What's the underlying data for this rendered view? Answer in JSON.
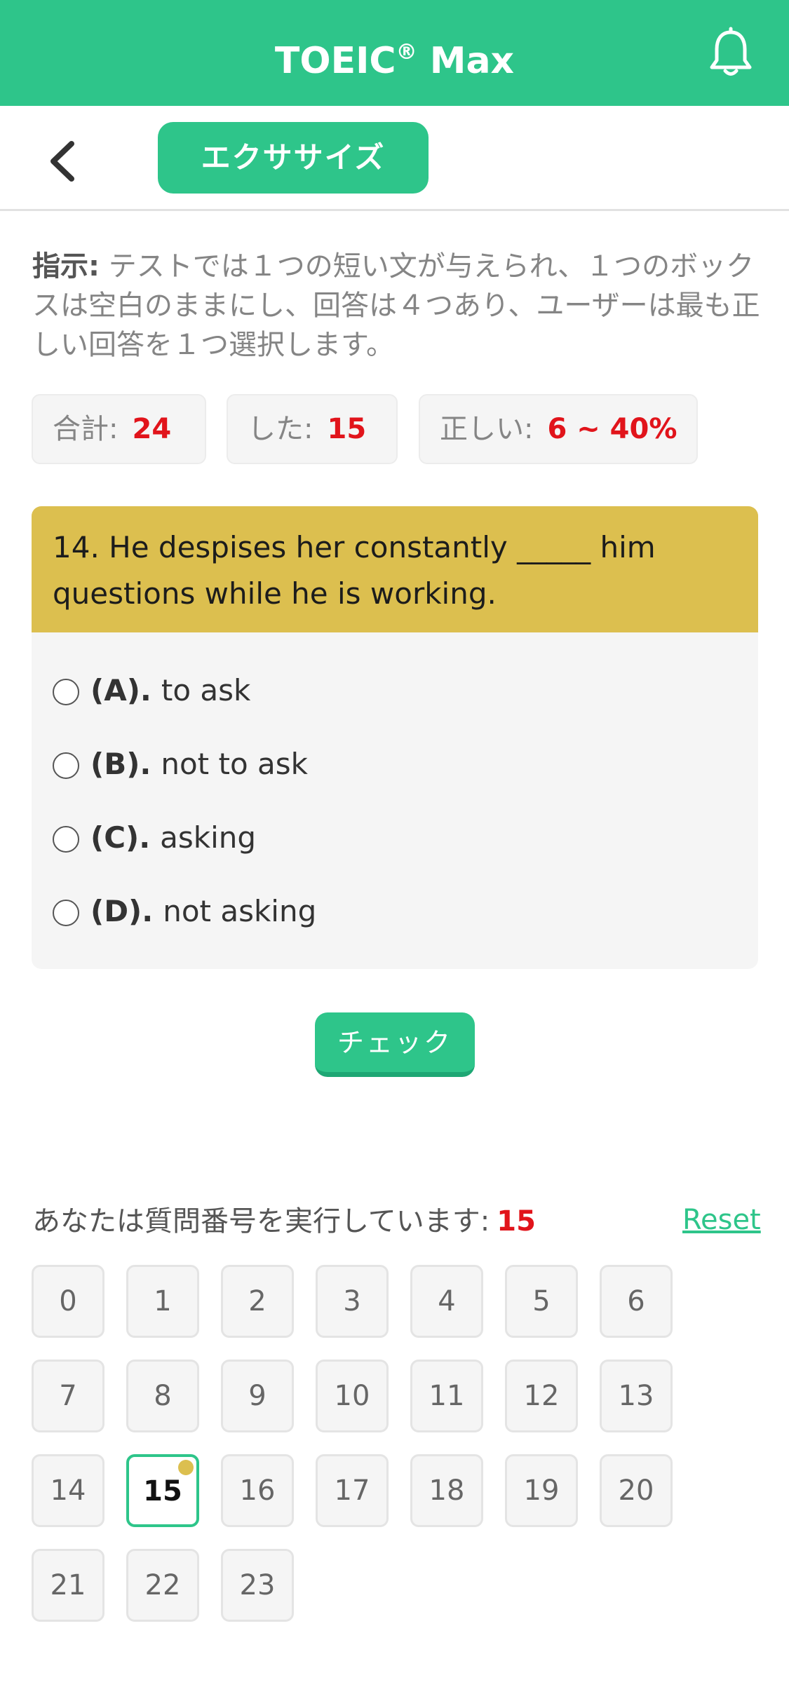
{
  "app": {
    "title": "TOEIC",
    "title_mark": "®",
    "title_suffix": " Max"
  },
  "icons": {
    "notification": "bell-icon",
    "back": "chevron-left-icon"
  },
  "nav": {
    "tab_label": "エクササイズ"
  },
  "instructions": {
    "label": "指示:",
    "text": " テストでは１つの短い文が与えられ、１つのボックスは空白のままにし、回答は４つあり、ユーザーは最も正しい回答を１つ選択します。"
  },
  "stats": {
    "total_label": "合計:",
    "total_value": "24",
    "done_label": "した:",
    "done_value": "15",
    "correct_label": "正しい:",
    "correct_value": "6 ~ 40%"
  },
  "question": {
    "text": "14. He despises her constantly _____ him questions while he is working.",
    "options": [
      {
        "label": "(A).",
        "text": "to ask"
      },
      {
        "label": "(B).",
        "text": "not to ask"
      },
      {
        "label": "(C).",
        "text": "asking"
      },
      {
        "label": "(D).",
        "text": "not asking"
      }
    ]
  },
  "check_label": "チェック",
  "progress": {
    "label": "あなたは質問番号を実行しています:",
    "current": "15",
    "reset_label": "Reset"
  },
  "question_numbers": [
    "0",
    "1",
    "2",
    "3",
    "4",
    "5",
    "6",
    "7",
    "8",
    "9",
    "10",
    "11",
    "12",
    "13",
    "14",
    "15",
    "16",
    "17",
    "18",
    "19",
    "20",
    "21",
    "22",
    "23"
  ],
  "active_question": "15",
  "colors": {
    "brand": "#2ec58a",
    "question_bg": "#dcbf4f",
    "accent_red": "#e1141b"
  }
}
